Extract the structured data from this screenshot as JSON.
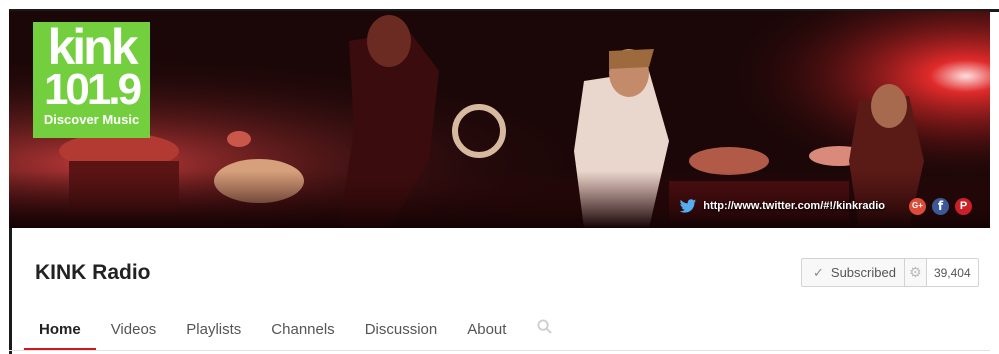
{
  "banner": {
    "logo": {
      "line1": "kink",
      "line2": "101.9",
      "line3": "Discover Music"
    },
    "link_url": "http://www.twitter.com/#!/kinkradio",
    "social_icons": [
      "twitter-icon",
      "google-plus-icon",
      "facebook-icon",
      "pinterest-icon"
    ],
    "social_glyphs": {
      "google_plus": "G+",
      "facebook": "f",
      "pinterest": "P"
    }
  },
  "channel": {
    "name": "KINK Radio",
    "subscribe_label": "Subscribed",
    "subscriber_count": "39,404"
  },
  "tabs": [
    {
      "label": "Home",
      "active": true
    },
    {
      "label": "Videos",
      "active": false
    },
    {
      "label": "Playlists",
      "active": false
    },
    {
      "label": "Channels",
      "active": false
    },
    {
      "label": "Discussion",
      "active": false
    },
    {
      "label": "About",
      "active": false
    }
  ],
  "colors": {
    "logo_green": "#74cf3f",
    "active_tab_underline": "#cc181e",
    "banner_red": "#a01515"
  }
}
